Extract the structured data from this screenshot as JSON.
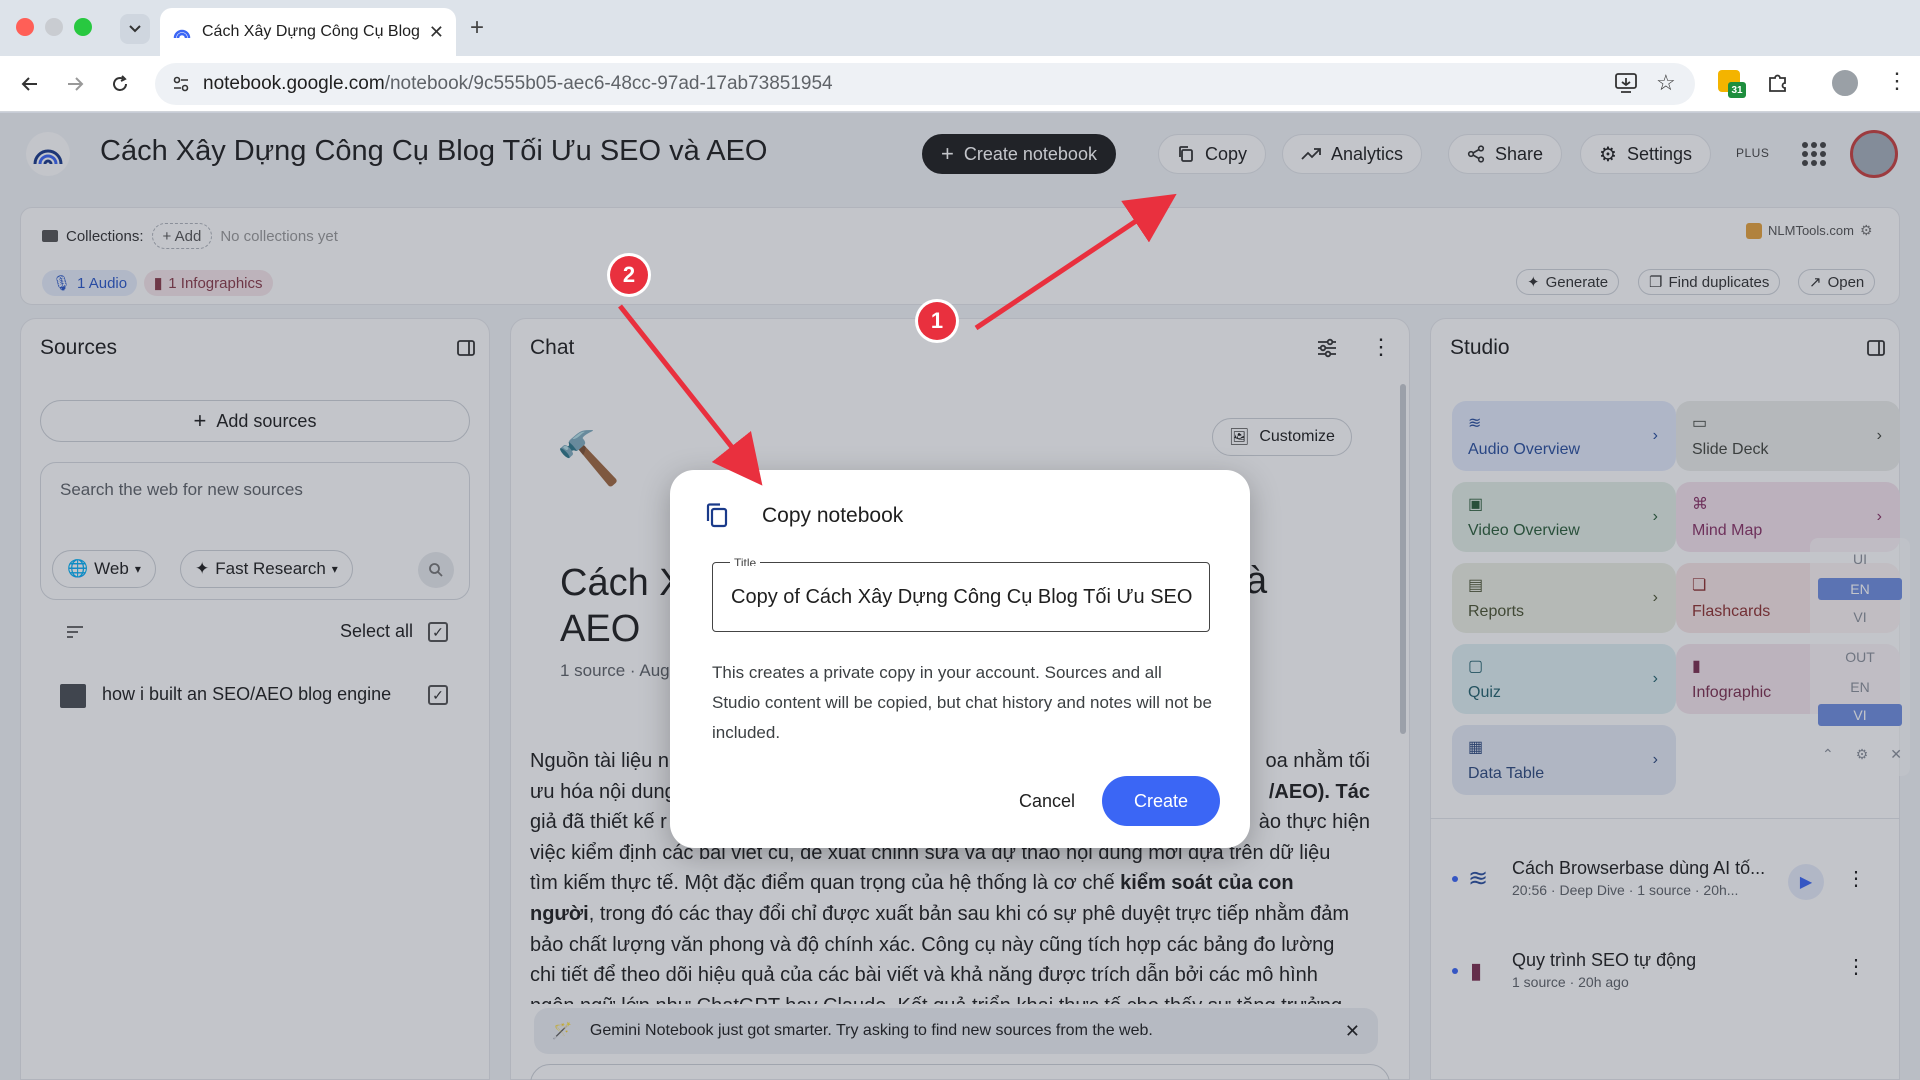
{
  "browser": {
    "tab_title": "Cách Xây Dựng Công Cụ Blog",
    "url_host": "notebook.google.com",
    "url_path": "/notebook/9c555b05-aec6-48cc-97ad-17ab73851954",
    "calendar_badge": "31"
  },
  "header": {
    "title": "Cách Xây Dựng Công Cụ Blog Tối Ưu SEO và AEO",
    "create_notebook": "Create notebook",
    "copy": "Copy",
    "analytics": "Analytics",
    "share": "Share",
    "settings": "Settings",
    "plan_badge": "PLUS"
  },
  "collections": {
    "label": "Collections:",
    "add": "+ Add",
    "empty": "No collections yet",
    "brand": "NLMTools.com",
    "chip_audio": "1 Audio",
    "chip_infographics": "1 Infographics",
    "generate": "Generate",
    "find_duplicates": "Find duplicates",
    "open": "Open"
  },
  "sources": {
    "title": "Sources",
    "add_sources": "Add sources",
    "search_placeholder": "Search the web for new sources",
    "web": "Web",
    "fast_research": "Fast Research",
    "select_all": "Select all",
    "items": [
      {
        "label": "how i built an SEO/AEO blog engine"
      }
    ]
  },
  "chat": {
    "title": "Chat",
    "customize": "Customize",
    "heading_line1": "Cách X",
    "heading_line2": "AEO",
    "heading_right": "à",
    "meta": "1 source · Aug",
    "body_lines": [
      "Nguồn tài liệu n",
      "ưu hóa nội dung",
      "giả đã thiết kế r",
      "việc kiểm định các bài viết cũ, đề xuất chỉnh sửa và dự thảo nội dung mới dựa trên dữ liệu",
      "tìm kiếm thực tế. Một đặc điểm quan trọng của hệ thống là cơ chế",
      "người",
      ", trong đó các thay đổi chỉ được xuất bản sau khi có sự phê duyệt trực tiếp nhằm đảm",
      "bảo chất lượng văn phong và độ chính xác. Công cụ này cũng tích hợp các bảng đo lường",
      "chi tiết để theo dõi hiệu quả của các bài viết và khả năng được trích dẫn bởi các mô hình",
      "ngôn ngữ lớn như ChatGPT hay Claude. Kết quả triển khai thực tế cho thấy sự tăng trưởng"
    ],
    "body_bold_1": "kiểm soát của con",
    "right_frag_1": "oa nhằm tối",
    "right_frag_2": "/AEO). Tác",
    "right_frag_3": "ào thực hiện",
    "gemini_notice": "Gemini Notebook just got smarter. Try asking to find new sources from the web."
  },
  "studio": {
    "title": "Studio",
    "cards": [
      {
        "label": "Audio Overview"
      },
      {
        "label": "Slide Deck"
      },
      {
        "label": "Video Overview"
      },
      {
        "label": "Mind Map"
      },
      {
        "label": "Reports"
      },
      {
        "label": "Flashcards"
      },
      {
        "label": "Quiz"
      },
      {
        "label": "Infographic"
      },
      {
        "label": "Data Table"
      }
    ],
    "artifacts": [
      {
        "title": "Cách Browserbase dùng AI tố...",
        "meta": "20:56 · Deep Dive · 1 source · 20h..."
      },
      {
        "title": "Quy trình SEO tự động",
        "meta": "1 source · 20h ago"
      }
    ]
  },
  "lang_panel": {
    "ui_label": "UI",
    "ui_en": "EN",
    "ui_vi": "VI",
    "out_label": "OUT",
    "out_en": "EN",
    "out_vi": "VI"
  },
  "dialog": {
    "title": "Copy notebook",
    "field_label": "Title",
    "field_value": "Copy of Cách Xây Dựng Công Cụ Blog Tối Ưu SEO",
    "description": "This creates a private copy in your account. Sources and all Studio content will be copied, but chat history and notes will not be included.",
    "cancel": "Cancel",
    "create": "Create"
  },
  "annotations": {
    "step1": "1",
    "step2": "2"
  },
  "colors": {
    "accent": "#3b66f5",
    "annotation": "#e9303e"
  }
}
